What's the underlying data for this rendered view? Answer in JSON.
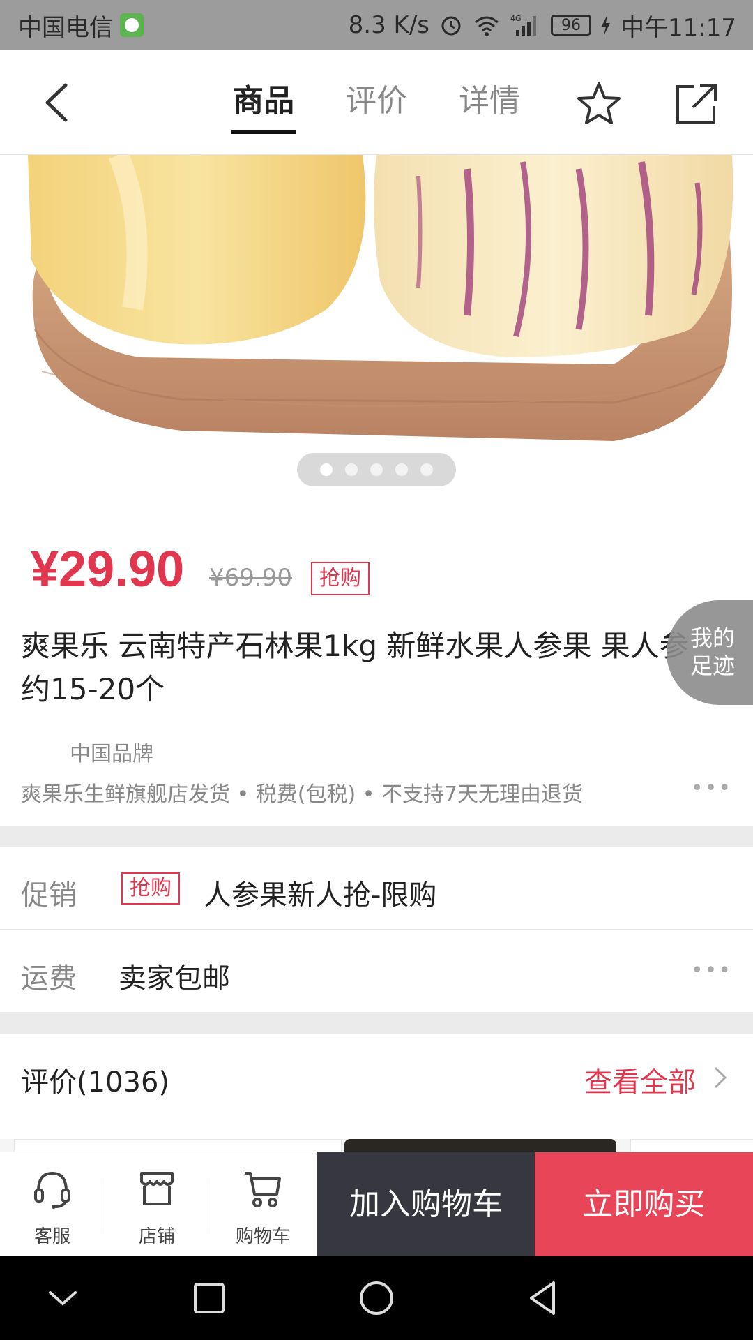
{
  "status_bar": {
    "carrier": "中国电信",
    "speed": "8.3 K/s",
    "network": "4G",
    "battery": "96",
    "time": "中午11:17"
  },
  "header": {
    "tabs": [
      {
        "label": "商品",
        "active": true
      },
      {
        "label": "评价",
        "active": false
      },
      {
        "label": "详情",
        "active": false
      }
    ]
  },
  "gallery": {
    "total_images": 5,
    "current_index": 1
  },
  "product": {
    "price": "¥29.90",
    "original_price": "¥69.90",
    "flash_tag": "抢购",
    "title": " 爽果乐 云南特产石林果1kg 新鲜水果人参果 果人参约15-20个",
    "brand": "中国品牌",
    "shipping_info": "爽果乐生鲜旗舰店发货 • 税费(包税) • 不支持7天无理由退货",
    "more": "•••"
  },
  "footprint": {
    "label_line1": "我的",
    "label_line2": "足迹"
  },
  "promo": {
    "label": "促销",
    "tag": "抢购",
    "text": "人参果新人抢-限购"
  },
  "freight": {
    "label": "运费",
    "text": "卖家包邮",
    "more": "•••"
  },
  "reviews": {
    "title": "评价(1036)",
    "view_all": "查看全部"
  },
  "action_bar": {
    "service": "客服",
    "store": "店铺",
    "cart": "购物车",
    "add_to_cart": "加入购物车",
    "buy_now": "立即购买"
  },
  "colors": {
    "accent_red": "#e0374e",
    "buy_now_bg": "#e84558",
    "add_cart_bg": "#37383f"
  }
}
